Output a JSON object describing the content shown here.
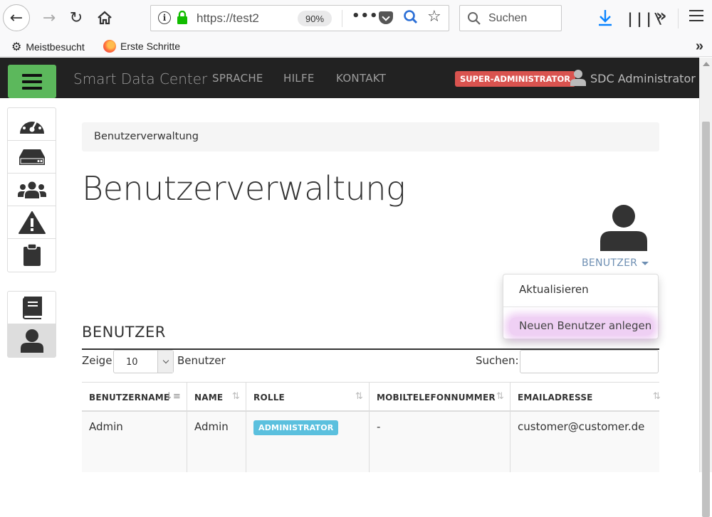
{
  "browser": {
    "url": "https://test2",
    "zoom": "90%",
    "search_placeholder": "Suchen",
    "bookmarks": [
      "Meistbesucht",
      "Erste Schritte"
    ]
  },
  "navbar": {
    "brand": "Smart Data Center",
    "links": [
      "SPRACHE",
      "HILFE",
      "KONTAKT"
    ],
    "role_badge": "SUPER-ADMINISTRATOR",
    "user_name": "SDC Administrator",
    "colors": {
      "bar": "#222222",
      "menu_button": "#5cb85c",
      "badge": "#d9534f"
    }
  },
  "sidebar": {
    "group1": [
      "dashboard-gauge-icon",
      "server-drive-icon",
      "users-group-icon",
      "warning-icon",
      "clipboard-icon"
    ],
    "group2": [
      "book-icon",
      "user-icon"
    ],
    "active": "user-icon"
  },
  "main": {
    "breadcrumb": "Benutzerverwaltung",
    "title": "Benutzerverwaltung",
    "dropdown_toggle": "BENUTZER",
    "dropdown_items": [
      "Aktualisieren",
      "Neuen Benutzer anlegen"
    ],
    "section_title": "BENUTZER",
    "length_prefix": "Zeige",
    "length_value": "10",
    "length_suffix": "Benutzer",
    "search_label": "Suchen:",
    "search_value": ""
  },
  "table": {
    "columns": [
      "BENUTZERNAME",
      "NAME",
      "ROLLE",
      "MOBILTELEFONNUMMER",
      "EMAILADRESSE"
    ],
    "rows": [
      {
        "username": "Admin",
        "name": "Admin",
        "role": "ADMINISTRATOR",
        "mobile": "-",
        "email": "customer@customer.de"
      }
    ]
  }
}
